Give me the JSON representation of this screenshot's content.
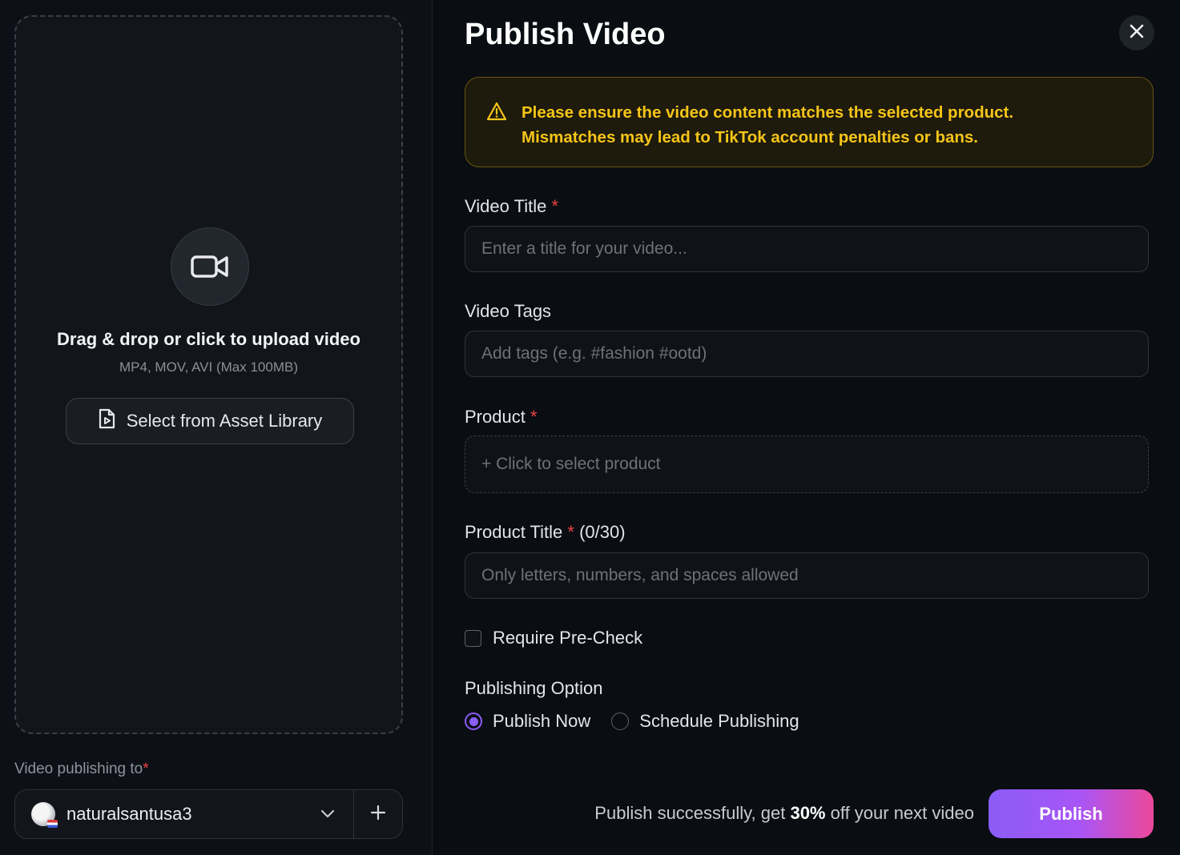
{
  "upload": {
    "title": "Drag & drop or click to upload video",
    "formats": "MP4, MOV, AVI (Max 100MB)",
    "asset_button": "Select from Asset Library"
  },
  "publishing_to": {
    "label": "Video publishing to",
    "required_mark": "*",
    "account_name": "naturalsantusa3"
  },
  "dialog": {
    "title": "Publish Video",
    "warning": {
      "line1": "Please ensure the video content matches the selected product.",
      "line2": "Mismatches may lead to TikTok account penalties or bans."
    }
  },
  "form": {
    "video_title": {
      "label": "Video Title",
      "required": "*",
      "placeholder": "Enter a title for your video..."
    },
    "video_tags": {
      "label": "Video Tags",
      "placeholder": "Add tags (e.g. #fashion #ootd)"
    },
    "product": {
      "label": "Product",
      "required": "*",
      "select_text": "+ Click to select product"
    },
    "product_title": {
      "label": "Product Title",
      "required": "*",
      "counter": "(0/30)",
      "placeholder": "Only letters, numbers, and spaces allowed"
    },
    "precheck": {
      "label": "Require Pre-Check",
      "checked": false
    },
    "publishing_option": {
      "label": "Publishing Option",
      "options": [
        {
          "label": "Publish Now",
          "selected": true
        },
        {
          "label": "Schedule Publishing",
          "selected": false
        }
      ]
    }
  },
  "footer": {
    "promo_before": "Publish successfully, get ",
    "promo_highlight": "30%",
    "promo_after": " off your next video",
    "publish_button": "Publish"
  },
  "colors": {
    "accent": "#8b5cf6",
    "warning_text": "#f5c518",
    "required": "#ef4444",
    "publish_gradient_end": "#ec4899"
  }
}
